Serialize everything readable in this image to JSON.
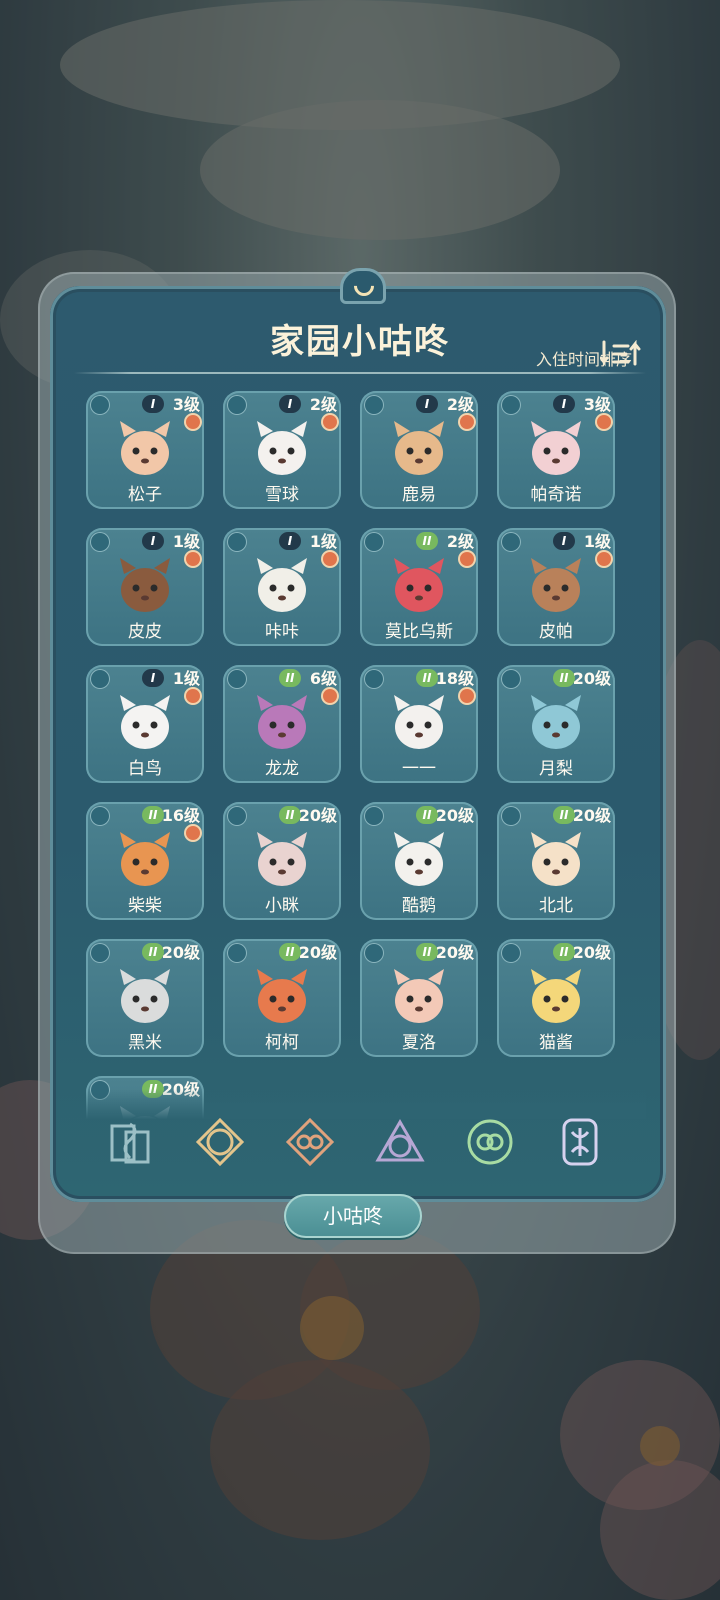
{
  "title": "家园小咕咚",
  "sort_label": "入住时间排序",
  "bottom_button": "小咕咚",
  "colors": {
    "panel": "#2b5a6d",
    "card": "#4c8290",
    "stage_one": "#22394a",
    "stage_two": "#78b95f",
    "badge_dot": "#e0754c"
  },
  "creatures": [
    {
      "name": "松子",
      "level": "3级",
      "stage": "I",
      "has_dot": true,
      "element_icon": "element-icon"
    },
    {
      "name": "雪球",
      "level": "2级",
      "stage": "I",
      "has_dot": true,
      "element_icon": "rune-icon"
    },
    {
      "name": "鹿易",
      "level": "2级",
      "stage": "I",
      "has_dot": true,
      "element_icon": "rune-icon"
    },
    {
      "name": "帕奇诺",
      "level": "3级",
      "stage": "I",
      "has_dot": true,
      "element_icon": "rune-icon"
    },
    {
      "name": "皮皮",
      "level": "1级",
      "stage": "I",
      "has_dot": true,
      "element_icon": "rune-icon"
    },
    {
      "name": "咔咔",
      "level": "1级",
      "stage": "I",
      "has_dot": true,
      "element_icon": "rune-icon"
    },
    {
      "name": "莫比乌斯",
      "level": "2级",
      "stage": "II",
      "has_dot": true,
      "element_icon": "rune-icon"
    },
    {
      "name": "皮帕",
      "level": "1级",
      "stage": "I",
      "has_dot": true,
      "element_icon": "rune-icon"
    },
    {
      "name": "白鸟",
      "level": "1级",
      "stage": "I",
      "has_dot": true,
      "element_icon": "rune-icon"
    },
    {
      "name": "龙龙",
      "level": "6级",
      "stage": "II",
      "has_dot": true,
      "element_icon": "sun-icon"
    },
    {
      "name": "一一",
      "level": "18级",
      "stage": "II",
      "has_dot": true,
      "element_icon": "rune-icon"
    },
    {
      "name": "月梨",
      "level": "20级",
      "stage": "II",
      "has_dot": false,
      "element_icon": "triangle-icon"
    },
    {
      "name": "柴柴",
      "level": "16级",
      "stage": "II",
      "has_dot": true,
      "element_icon": "sun-icon"
    },
    {
      "name": "小眯",
      "level": "20级",
      "stage": "II",
      "has_dot": false,
      "element_icon": "knot-icon"
    },
    {
      "name": "酷鹅",
      "level": "20级",
      "stage": "II",
      "has_dot": false,
      "element_icon": "music-icon"
    },
    {
      "name": "北北",
      "level": "20级",
      "stage": "II",
      "has_dot": false,
      "element_icon": "knot-icon"
    },
    {
      "name": "黑米",
      "level": "20级",
      "stage": "II",
      "has_dot": false,
      "element_icon": "triangle-icon"
    },
    {
      "name": "柯柯",
      "level": "20级",
      "stage": "II",
      "has_dot": false,
      "element_icon": "knot-icon"
    },
    {
      "name": "夏洛",
      "level": "20级",
      "stage": "II",
      "has_dot": false,
      "element_icon": "swirl-icon"
    },
    {
      "name": "猫酱",
      "level": "20级",
      "stage": "II",
      "has_dot": false,
      "element_icon": "sun-icon"
    },
    {
      "name": "",
      "level": "20级",
      "stage": "II",
      "has_dot": false,
      "element_icon": "music-icon"
    }
  ],
  "tabs": [
    {
      "icon": "music-element-icon",
      "color": "#9cc0c6"
    },
    {
      "icon": "sun-element-icon",
      "color": "#e3c48b"
    },
    {
      "icon": "knot-element-icon",
      "color": "#e0a27c"
    },
    {
      "icon": "triangle-element-icon",
      "color": "#b6a7d4"
    },
    {
      "icon": "swirl-element-icon",
      "color": "#a8dca3"
    },
    {
      "icon": "rune-element-icon",
      "color": "#d6d2ef"
    }
  ]
}
